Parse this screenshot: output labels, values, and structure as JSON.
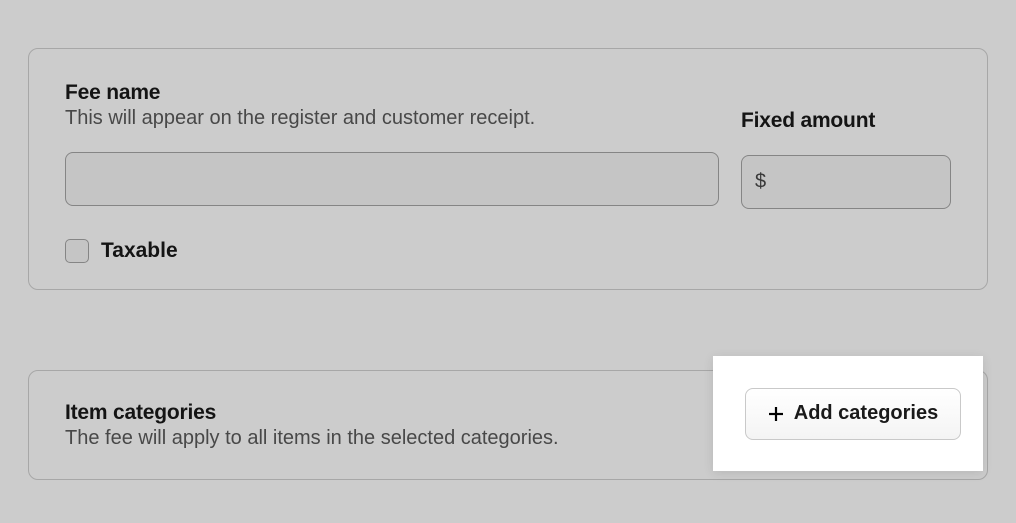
{
  "fee": {
    "name_label": "Fee name",
    "name_help": "This will appear on the register and customer receipt.",
    "amount_label": "Fixed amount",
    "currency_prefix": "$",
    "name_value": "",
    "amount_value": "",
    "taxable_label": "Taxable"
  },
  "categories": {
    "title": "Item categories",
    "help": "The fee will apply to all items in the selected categories.",
    "add_button": "Add categories"
  }
}
